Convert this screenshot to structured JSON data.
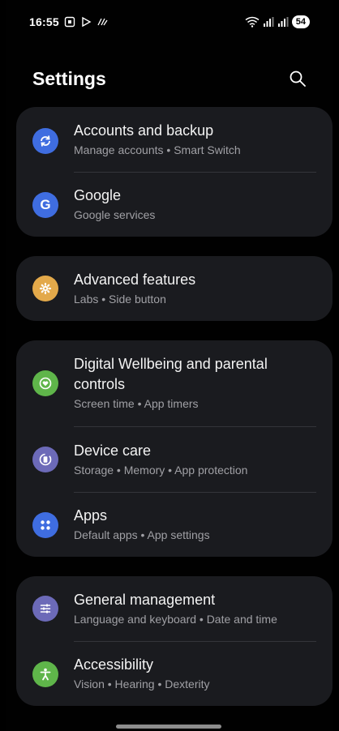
{
  "status_bar": {
    "time": "16:55",
    "battery": "54"
  },
  "header": {
    "title": "Settings"
  },
  "groups": [
    {
      "items": [
        {
          "title": "Accounts and backup",
          "subtitle": "Manage accounts  •  Smart Switch",
          "icon": "sync-icon",
          "color": "#3f6de0"
        },
        {
          "title": "Google",
          "subtitle": "Google services",
          "icon": "google-icon",
          "color": "#3f6de0"
        }
      ]
    },
    {
      "items": [
        {
          "title": "Advanced features",
          "subtitle": "Labs  •  Side button",
          "icon": "star-gear-icon",
          "color": "#e3a94a"
        }
      ]
    },
    {
      "items": [
        {
          "title": "Digital Wellbeing and parental controls",
          "subtitle": "Screen time  •  App timers",
          "icon": "heart-circle-icon",
          "color": "#5fb54a"
        },
        {
          "title": "Device care",
          "subtitle": "Storage  •  Memory  •  App protection",
          "icon": "device-care-icon",
          "color": "#6c6ab8"
        },
        {
          "title": "Apps",
          "subtitle": "Default apps  •  App settings",
          "icon": "apps-grid-icon",
          "color": "#3f6de0"
        }
      ]
    },
    {
      "items": [
        {
          "title": "General management",
          "subtitle": "Language and keyboard  •  Date and time",
          "icon": "sliders-icon",
          "color": "#6c6ab8"
        },
        {
          "title": "Accessibility",
          "subtitle": "Vision  •  Hearing  •  Dexterity",
          "icon": "accessibility-icon",
          "color": "#5fb54a"
        }
      ]
    }
  ]
}
